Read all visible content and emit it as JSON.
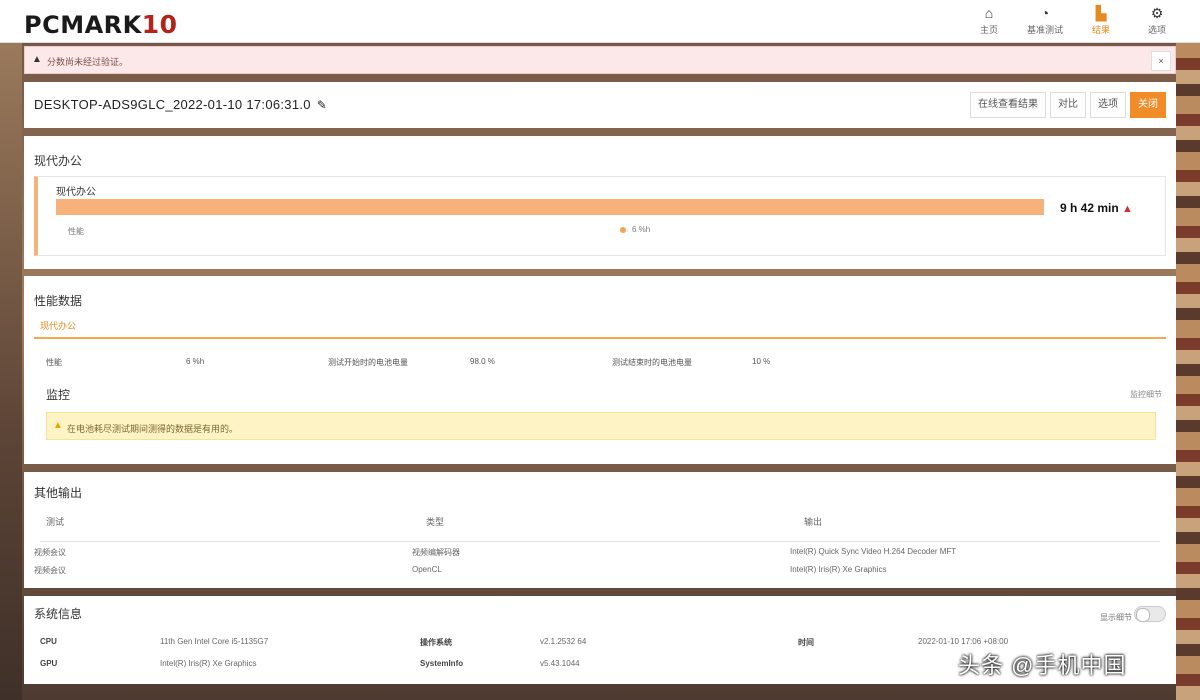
{
  "app": {
    "logo_main": "PCMARK",
    "logo_num": "10"
  },
  "nav": [
    {
      "label": "主页",
      "icon": "home-icon"
    },
    {
      "label": "基准测试",
      "icon": "gauge-icon"
    },
    {
      "label": "结果",
      "icon": "results-icon"
    },
    {
      "label": "选项",
      "icon": "gear-icon"
    }
  ],
  "alert": {
    "text": "分数尚未经过验证。",
    "close": "×"
  },
  "result": {
    "name": "DESKTOP-ADS9GLC_2022-01-10 17:06:31.0",
    "buttons": [
      "在线查看结果",
      "对比",
      "选项",
      "关闭"
    ]
  },
  "office": {
    "section_title": "现代办公",
    "item_label": "现代办公",
    "value": "9 h 42 min",
    "perf_label": "性能",
    "dot_value": "6 %h"
  },
  "perf_data": {
    "section_title": "性能数据",
    "tab": "现代办公",
    "stats": [
      {
        "label": "性能",
        "value": "6 %h"
      },
      {
        "label": "测试开始时的电池电量",
        "value": "98.0 %"
      },
      {
        "label": "测试结束时的电池电量",
        "value": "10 %"
      }
    ],
    "monitor_title": "监控",
    "monitor_right": "监控细节",
    "warning": "在电池耗尽测试期间测得的数据是有用的。"
  },
  "other_output": {
    "section_title": "其他输出",
    "headers": [
      "测试",
      "类型",
      "输出"
    ],
    "rows": [
      [
        "视频会议",
        "视频编解码器",
        "Intel(R) Quick Sync Video H.264 Decoder MFT"
      ],
      [
        "视频会议",
        "OpenCL",
        "Intel(R) Iris(R) Xe Graphics"
      ]
    ]
  },
  "system": {
    "section_title": "系统信息",
    "toggle_label": "显示细节",
    "rows": [
      [
        {
          "k": "CPU",
          "v": "11th Gen Intel Core i5-1135G7"
        },
        {
          "k": "操作系统",
          "v": "v2.1.2532 64"
        },
        {
          "k": "时间",
          "v": "2022-01-10 17:06 +08:00"
        }
      ],
      [
        {
          "k": "GPU",
          "v": "Intel(R) Iris(R) Xe Graphics"
        },
        {
          "k": "SystemInfo",
          "v": "v5.43.1044"
        },
        {
          "k": "",
          "v": ""
        }
      ]
    ]
  },
  "watermark": "头条 @手机中国",
  "colors": {
    "accent": "#f28c28",
    "bar": "#f6b27a",
    "alert_bg": "#fce8e8",
    "warning_bg": "#fdf3c4"
  }
}
